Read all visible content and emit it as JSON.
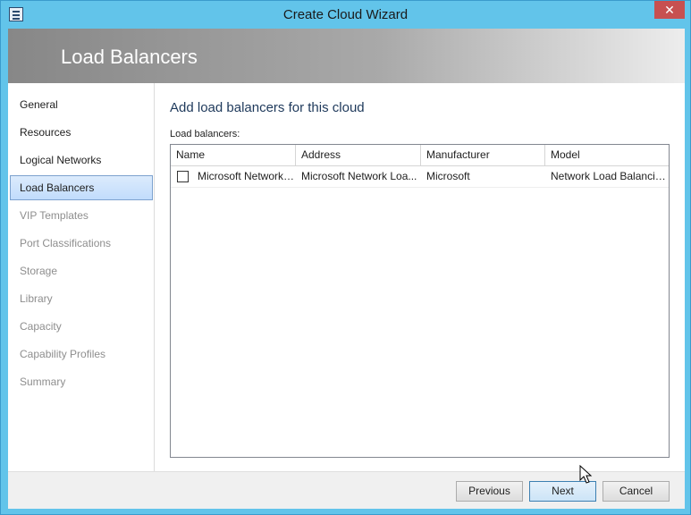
{
  "window": {
    "title": "Create Cloud Wizard",
    "close_glyph": "✕"
  },
  "banner": {
    "title": "Load Balancers"
  },
  "nav": {
    "items": [
      {
        "label": "General",
        "state": "enabled"
      },
      {
        "label": "Resources",
        "state": "enabled"
      },
      {
        "label": "Logical Networks",
        "state": "enabled"
      },
      {
        "label": "Load Balancers",
        "state": "selected"
      },
      {
        "label": "VIP Templates",
        "state": "disabled"
      },
      {
        "label": "Port Classifications",
        "state": "disabled"
      },
      {
        "label": "Storage",
        "state": "disabled"
      },
      {
        "label": "Library",
        "state": "disabled"
      },
      {
        "label": "Capacity",
        "state": "disabled"
      },
      {
        "label": "Capability Profiles",
        "state": "disabled"
      },
      {
        "label": "Summary",
        "state": "disabled"
      }
    ]
  },
  "content": {
    "heading": "Add load balancers for this cloud",
    "list_label": "Load balancers:",
    "columns": [
      "Name",
      "Address",
      "Manufacturer",
      "Model"
    ],
    "rows": [
      {
        "checked": false,
        "cells": [
          "Microsoft Network Lo",
          "Microsoft Network Loa...",
          "Microsoft",
          "Network Load Balancin..."
        ]
      }
    ]
  },
  "footer": {
    "previous_label": "Previous",
    "next_label": "Next",
    "cancel_label": "Cancel"
  },
  "colors": {
    "window_frame": "#62c4ea",
    "close_button": "#c75050",
    "heading": "#1e395b",
    "selected_nav": "#c1dcfc"
  }
}
